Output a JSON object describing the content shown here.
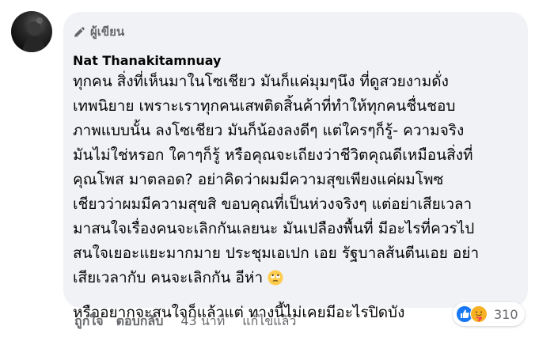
{
  "comment": {
    "author_badge": "ผู้เขียน",
    "author_name": "Nat Thanakitamnuay",
    "body_lines": [
      "ทุกคน สิ่งที่เห็นมาในโซเชียว มันก็แค่มุมๆนึง ที่ดูสวยงามดั่ง",
      "เทพนิยาย เพราะเราทุกคนเสพติดสิ้นค้าที่ทำให้ทุกคนชื่นชอบ",
      "ภาพแบบนั้น ลงโซเชียว มันก็น้องลงดีๆ แต่ใครๆก็รู้- ความจริง",
      "มันไม่ใช่หรอก ใคาๆก็รู้ หรือคุณจะเถียงว่าชีวิตคุณดีเหมือนสิ่งที่",
      "คุณโพส มาตลอด? อย่าคิดว่าผมมีความสุขเพียงแค่ผมโพซ",
      "เชียวว่าผมมีความสุขสิ ขอบคุณที่เป็นห่วงจริงๆ แต่อย่าเสียเวลา",
      "มาสนใจเรื่องคนจะเลิกกันเลยนะ มันเปลืองพื้นที่ มีอะไรที่ควรไป",
      "สนใจเยอะแยะมากมาย ประชุมเอเปก เอย รัฐบาลส้นตีนเอย อย่า",
      "เสียเวลากับ คนจะเลิกกัน อีห่า"
    ],
    "last_line": "หรืออยากจะสนใจก็แล้วแต่ ทางนี้ไม่เคยมีอะไรปิดบัง",
    "emoji_name": "face-with-rolling-eyes-icon"
  },
  "reactions": {
    "icons": [
      "like-reaction-icon",
      "care-reaction-icon"
    ],
    "count": "310"
  },
  "actions": {
    "like": "ถูกใจ",
    "reply": "ตอบกลับ",
    "time": "43 นาที",
    "edited": "แก้ไขแล้ว"
  },
  "colors": {
    "bubble": "#f0f2f5",
    "text": "#050505",
    "secondary": "#65676b",
    "like_blue": "#1877f2",
    "care_yellow": "#f7b125"
  }
}
